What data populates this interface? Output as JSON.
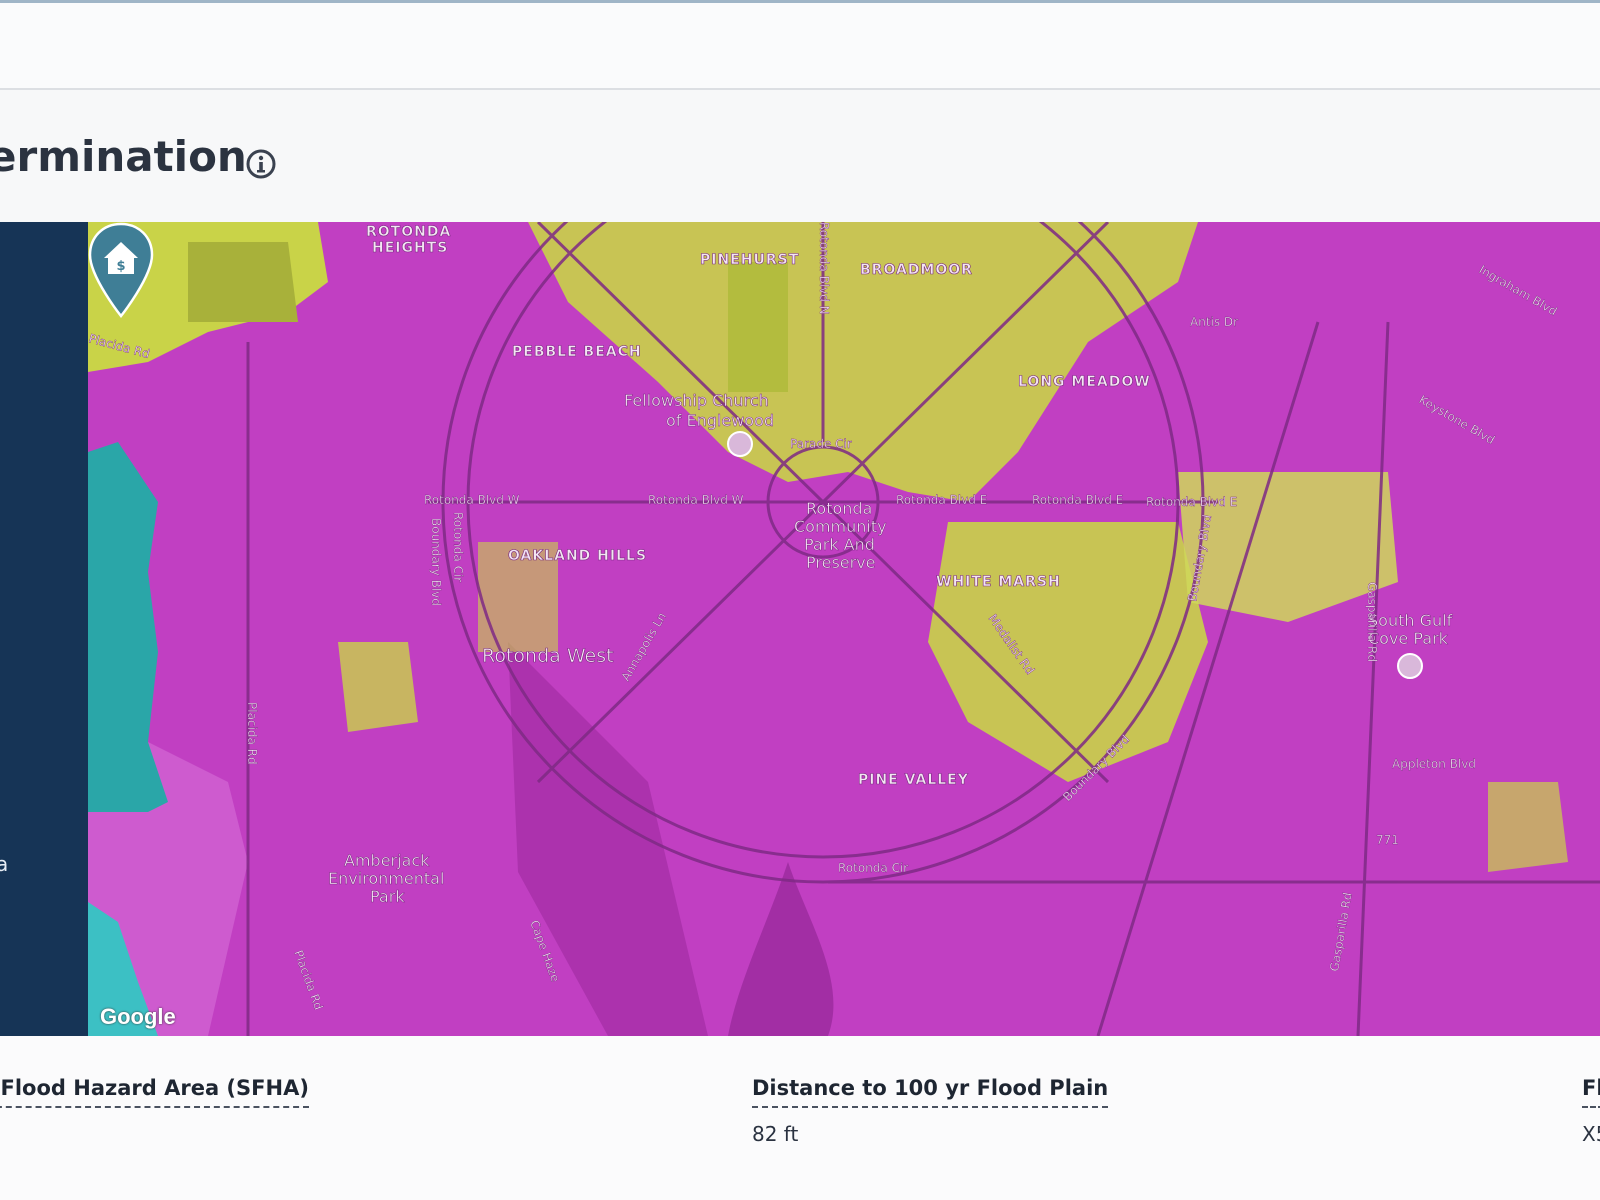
{
  "header": {
    "title": "ermination",
    "info_icon": "info-circle-icon"
  },
  "side_panel": {
    "text": "a",
    "color": "#163456"
  },
  "map": {
    "attribution": "Google",
    "pin_icon": "house-dollar-pin-icon",
    "colors": {
      "flood_magenta": "#c13fc2",
      "flood_yellow": "#c9d348",
      "water_teal": "#2aa6a8",
      "pin": "#3f7e96"
    },
    "labels": {
      "rotonda_heights_1": "ROTONDA",
      "rotonda_heights_2": "HEIGHTS",
      "pinehurst": "PINEHURST",
      "broadmoor": "BROADMOOR",
      "pebble_beach": "PEBBLE BEACH",
      "long_meadow": "LONG MEADOW",
      "fellowship_1": "Fellowship Church",
      "fellowship_2": "of Englewood",
      "rotonda_blvd_w_1": "Rotonda Blvd W",
      "rotonda_blvd_w_2": "Rotonda Blvd W",
      "rotonda_blvd_e_1": "Rotonda Blvd E",
      "rotonda_blvd_e_2": "Rotonda Blvd E",
      "rotonda_blvd_e_3": "Rotonda Blvd E",
      "park_1": "Rotonda",
      "park_2": "Community",
      "park_3": "Park And",
      "park_4": "Preserve",
      "oakland_hills": "OAKLAND HILLS",
      "white_marsh": "WHITE MARSH",
      "rotonda_west": "Rotonda West",
      "pine_valley": "PINE VALLEY",
      "south_gulf_1": "South Gulf",
      "south_gulf_2": "Cove Park",
      "appleton": "Appleton Blvd",
      "amberjack_1": "Amberjack",
      "amberjack_2": "Environmental",
      "amberjack_3": "Park",
      "placida_rd_1": "Placida Rd",
      "placida_rd_2": "Placida Rd",
      "placida_rd_3": "Placida Rd",
      "boundary_blvd_1": "Boundary Blvd",
      "boundary_blvd_2": "Boundary Blvd",
      "boundary_blvd_3": "Boundary Blvd",
      "rotonda_cir_1": "Rotonda Cir",
      "rotonda_cir_2": "Rotonda Cir",
      "parade_cir": "Parade Cir",
      "annapolis": "Annapolis Ln",
      "medalist": "Medalist Rd",
      "gasparilla_1": "Gasparilla Rd",
      "gasparilla_2": "Gasparilla Rd",
      "antis": "Antis Dr",
      "keystone": "Keystone Blvd",
      "ingraham": "Ingraham Blvd",
      "rotonda_blvd_n": "Rotonda Blvd N",
      "route_771": "771",
      "cape_haze": "Cape Haze"
    }
  },
  "fields": [
    {
      "label": "l Flood Hazard Area (SFHA)",
      "value": ""
    },
    {
      "label": "Distance to 100 yr Flood Plain",
      "value": "82 ft"
    },
    {
      "label": "Fl",
      "value": "X5"
    }
  ]
}
